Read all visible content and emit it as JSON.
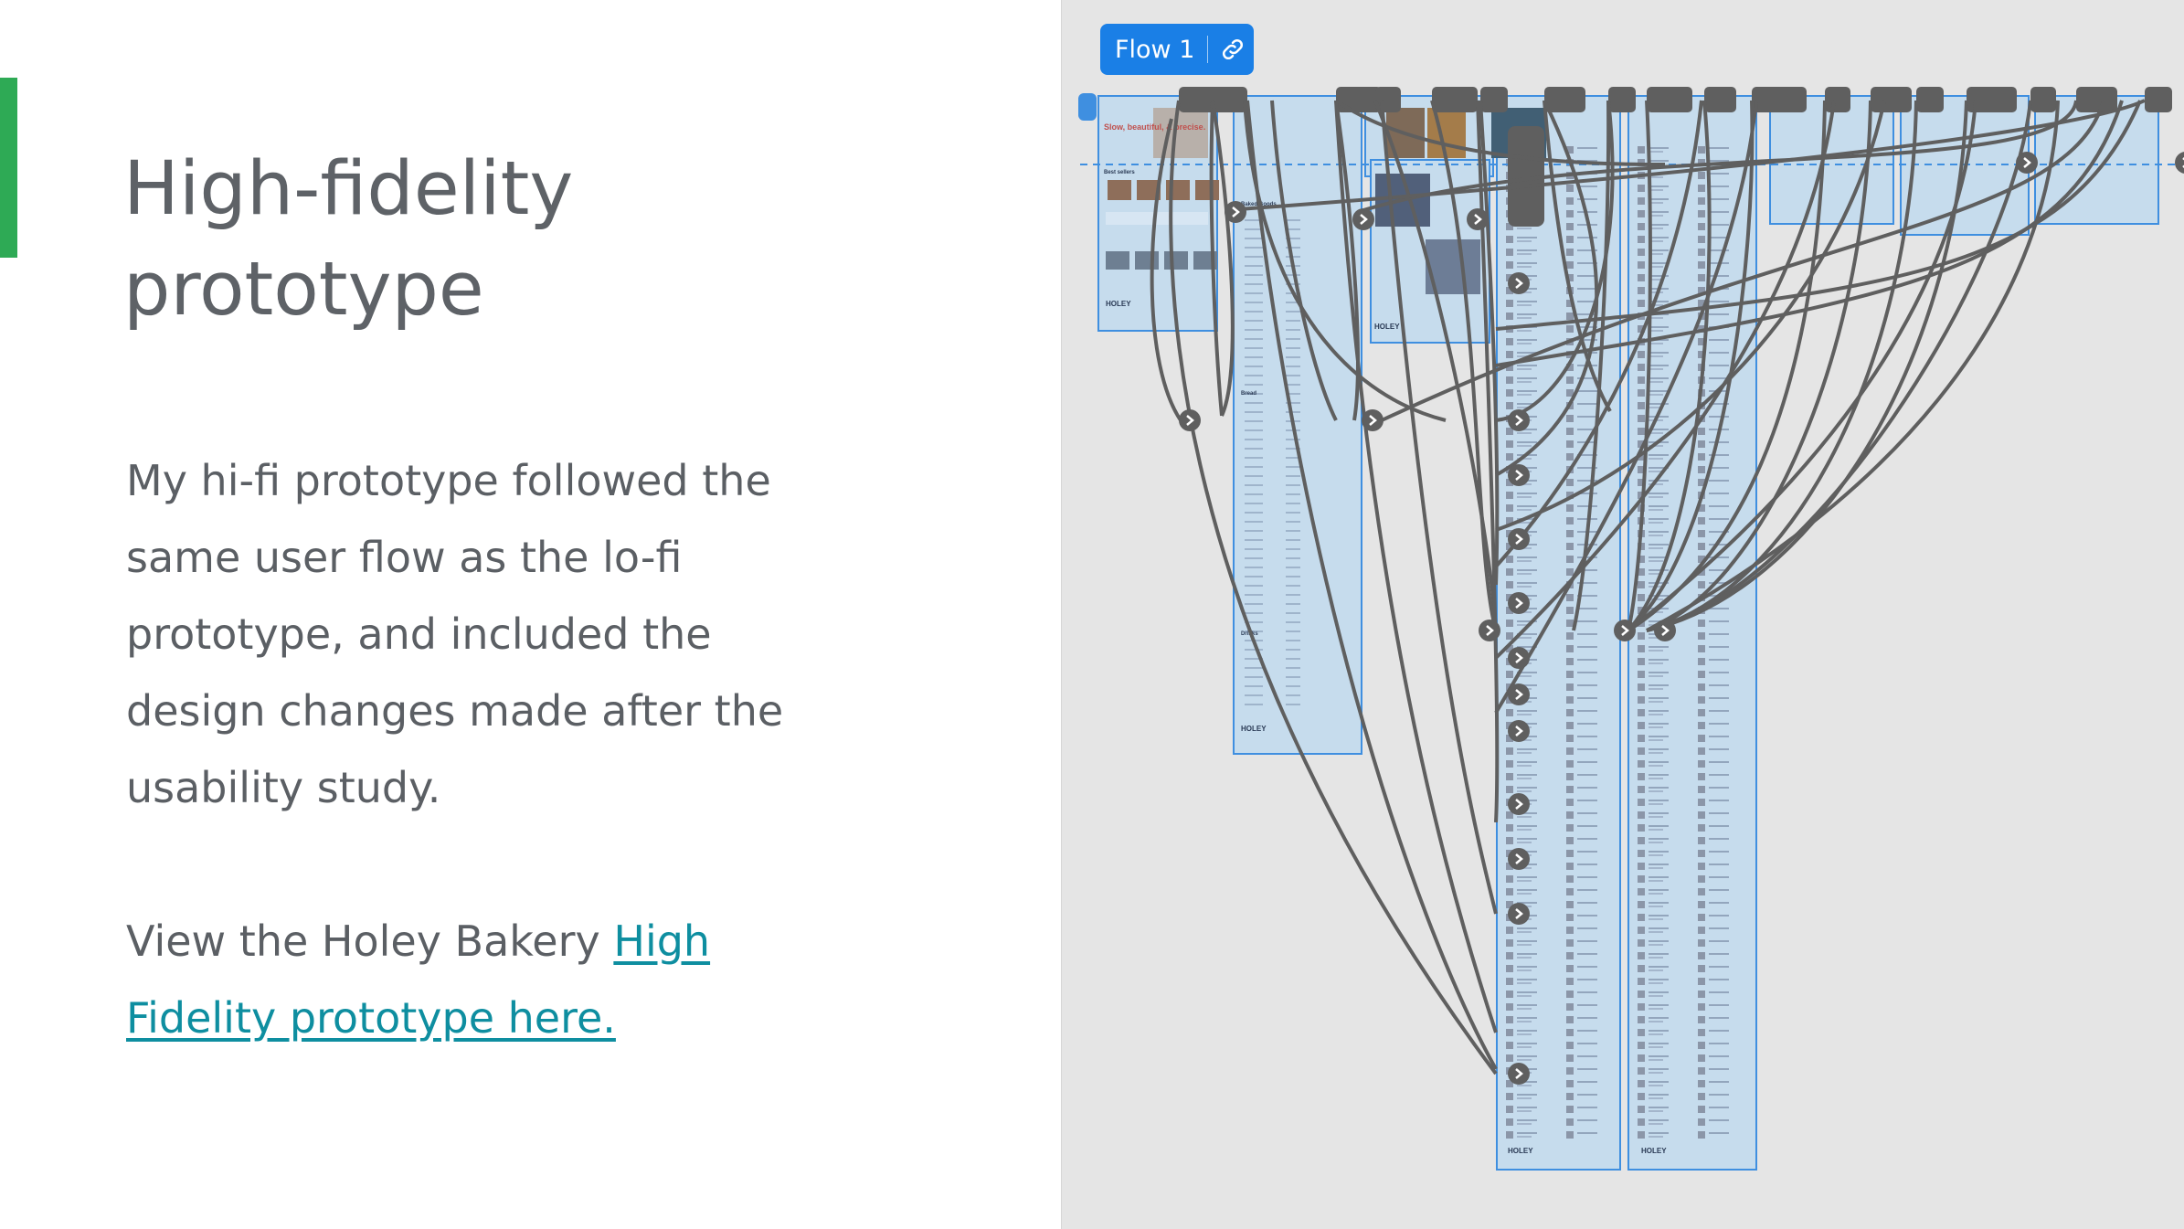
{
  "slide": {
    "title_line1": "High-fidelity",
    "title_line2": "prototype",
    "paragraph": "My hi-fi prototype followed the same user flow as the lo-fi prototype, and included the design changes made after the usability study.",
    "view_prefix": "View the Holey Bakery ",
    "link_text": "High Fidelity prototype here."
  },
  "canvas": {
    "flow_label": "Flow 1",
    "frame_texts": {
      "hero": "Slow, beautiful, & precise.",
      "best_sellers": "Best sellers",
      "baked_goods": "Baked Goods",
      "bread": "Bread",
      "drinks": "Drinks",
      "menu": "Menu",
      "brand": "HOLEY"
    }
  },
  "colors": {
    "accent_green": "#2eaa55",
    "link_teal": "#0e8ea0",
    "flow_blue": "#1a7fe6",
    "frame_fill": "#c6dced",
    "connector_gray": "#5f5f5f"
  }
}
